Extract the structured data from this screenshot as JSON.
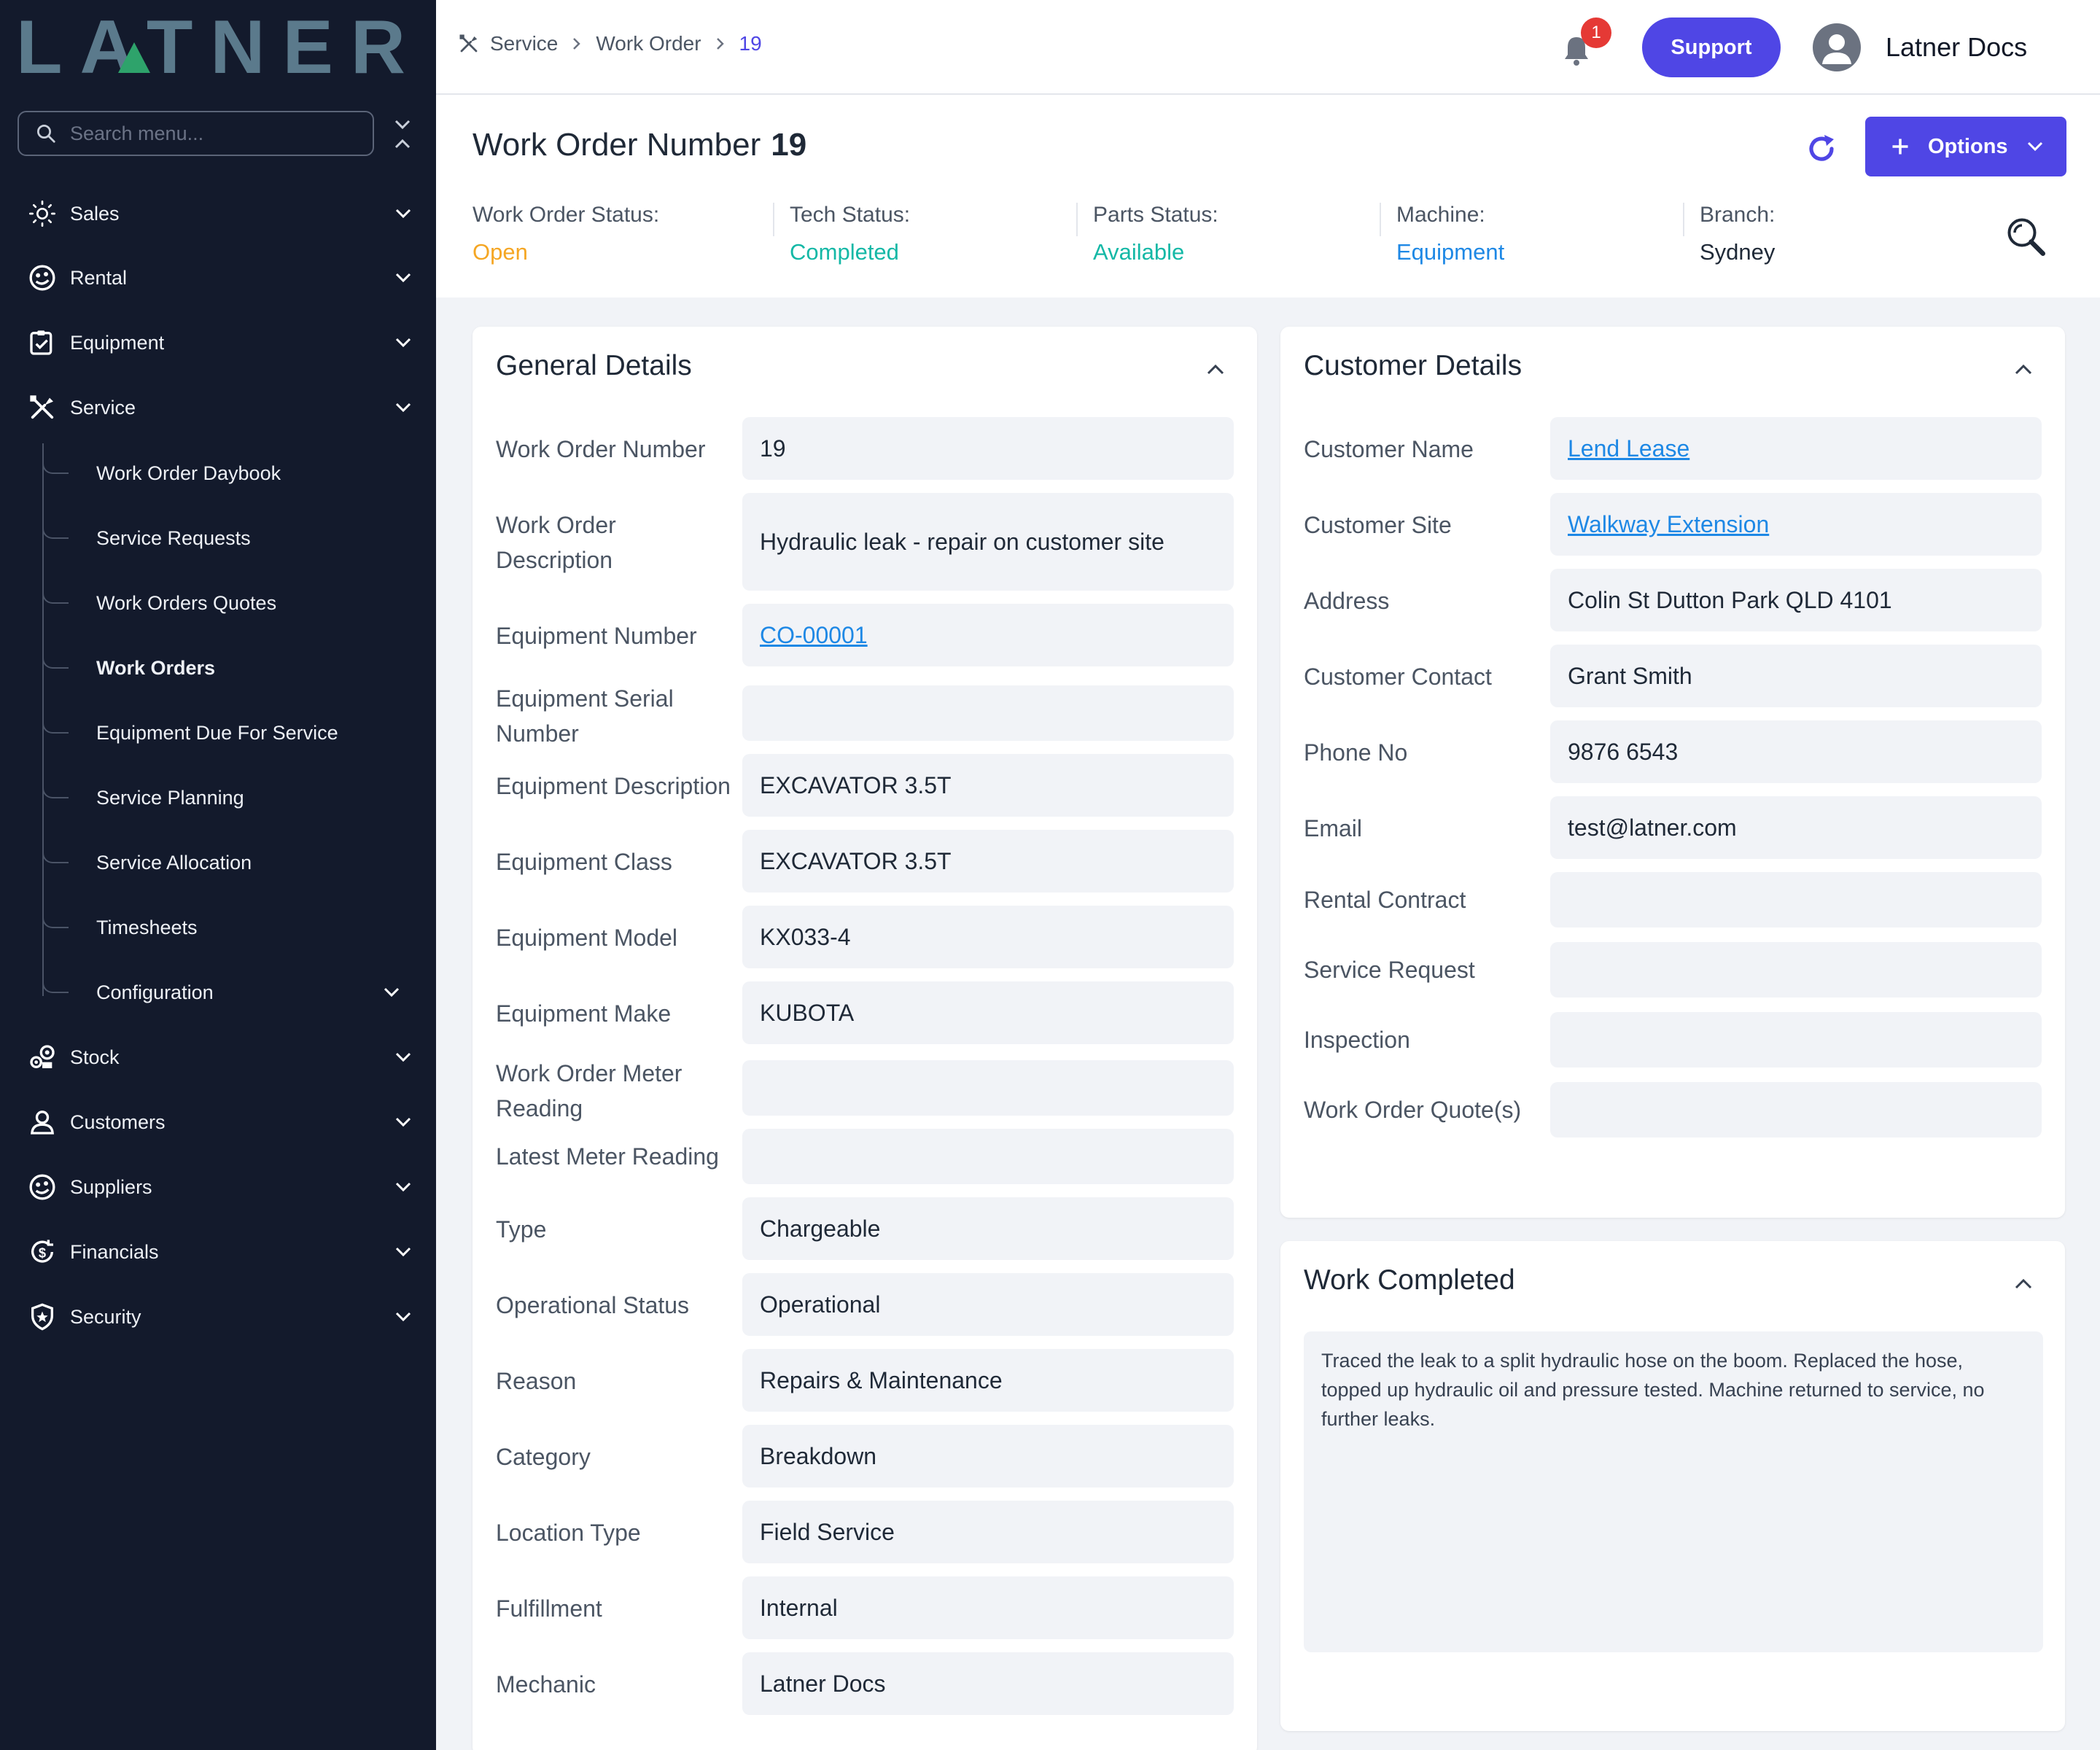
{
  "brand": {
    "logo_text": "LATNER"
  },
  "sidebar": {
    "search_placeholder": "Search menu...",
    "items": [
      {
        "label": "Sales",
        "icon": "sales-icon"
      },
      {
        "label": "Rental",
        "icon": "rental-icon"
      },
      {
        "label": "Equipment",
        "icon": "equipment-icon"
      },
      {
        "label": "Service",
        "icon": "service-icon"
      },
      {
        "label": "Stock",
        "icon": "stock-icon"
      },
      {
        "label": "Customers",
        "icon": "customers-icon"
      },
      {
        "label": "Suppliers",
        "icon": "suppliers-icon"
      },
      {
        "label": "Financials",
        "icon": "financials-icon"
      },
      {
        "label": "Security",
        "icon": "security-icon"
      }
    ],
    "service_sub": [
      {
        "label": "Work Order Daybook"
      },
      {
        "label": "Service Requests"
      },
      {
        "label": "Work Orders Quotes"
      },
      {
        "label": "Work Orders",
        "active": true
      },
      {
        "label": "Equipment Due For Service"
      },
      {
        "label": "Service Planning"
      },
      {
        "label": "Service Allocation"
      },
      {
        "label": "Timesheets"
      },
      {
        "label": "Configuration"
      }
    ]
  },
  "topbar": {
    "breadcrumb": [
      "Service",
      "Work Order",
      "19"
    ],
    "notification_count": "1",
    "support_label": "Support",
    "user_name": "Latner Docs"
  },
  "header": {
    "title_prefix": "Work Order Number",
    "title_number": "19",
    "options_label": "Options",
    "statuses": [
      {
        "label": "Work Order Status:",
        "value": "Open",
        "color": "#f5a623"
      },
      {
        "label": "Tech Status:",
        "value": "Completed",
        "color": "#14b8a6"
      },
      {
        "label": "Parts Status:",
        "value": "Available",
        "color": "#14b8a6"
      },
      {
        "label": "Machine:",
        "value": "Equipment",
        "color": "#1e88e5"
      },
      {
        "label": "Branch:",
        "value": "Sydney",
        "color": "#1f2937"
      }
    ]
  },
  "general_details": {
    "title": "General Details",
    "rows": [
      {
        "label": "Work Order Number",
        "value": "19"
      },
      {
        "label": "Work Order Description",
        "value": "Hydraulic leak - repair on customer site"
      },
      {
        "label": "Equipment Number",
        "value": "CO-00001",
        "link": true
      },
      {
        "label": "Equipment Serial Number",
        "value": ""
      },
      {
        "label": "Equipment Description",
        "value": "EXCAVATOR 3.5T"
      },
      {
        "label": "Equipment Class",
        "value": "EXCAVATOR 3.5T"
      },
      {
        "label": "Equipment Model",
        "value": "KX033-4"
      },
      {
        "label": "Equipment Make",
        "value": "KUBOTA"
      },
      {
        "label": "Work Order Meter Reading",
        "value": ""
      },
      {
        "label": "Latest Meter Reading",
        "value": ""
      },
      {
        "label": "Type",
        "value": "Chargeable"
      },
      {
        "label": "Operational Status",
        "value": "Operational"
      },
      {
        "label": "Reason",
        "value": "Repairs & Maintenance"
      },
      {
        "label": "Category",
        "value": "Breakdown"
      },
      {
        "label": "Location Type",
        "value": "Field Service"
      },
      {
        "label": "Fulfillment",
        "value": "Internal"
      },
      {
        "label": "Mechanic",
        "value": "Latner Docs"
      }
    ]
  },
  "customer_details": {
    "title": "Customer Details",
    "rows": [
      {
        "label": "Customer Name",
        "value": "Lend Lease",
        "link": true
      },
      {
        "label": "Customer Site",
        "value": "Walkway Extension",
        "link": true
      },
      {
        "label": "Address",
        "value": "Colin St Dutton Park QLD 4101"
      },
      {
        "label": "Customer Contact",
        "value": "Grant Smith"
      },
      {
        "label": "Phone No",
        "value": "9876 6543"
      },
      {
        "label": "Email",
        "value": "test@latner.com"
      },
      {
        "label": "Rental Contract",
        "value": ""
      },
      {
        "label": "Service Request",
        "value": ""
      },
      {
        "label": "Inspection",
        "value": ""
      },
      {
        "label": "Work Order Quote(s)",
        "value": ""
      }
    ]
  },
  "work_completed": {
    "title": "Work Completed",
    "text": "Traced the leak to a split hydraulic hose on the boom. Replaced the hose, topped up hydraulic oil and pressure tested. Machine returned to service, no further leaks."
  },
  "colors": {
    "accent": "#4f46e5",
    "sidebar_bg": "#131a2c",
    "link": "#1e88e5"
  }
}
